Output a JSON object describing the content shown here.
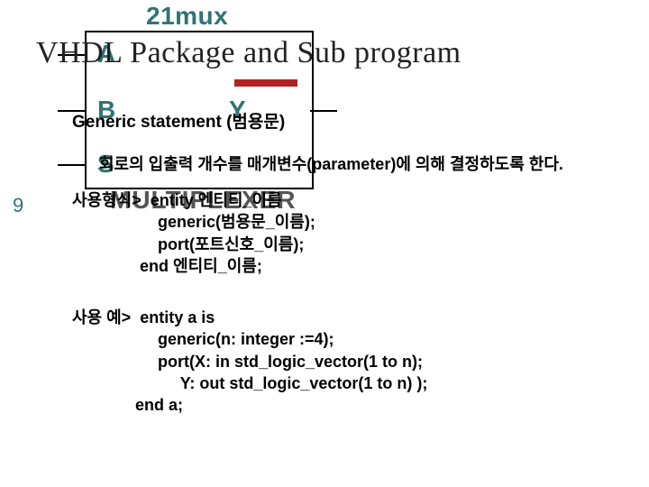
{
  "schematic": {
    "title": "21mux",
    "port_a": "A",
    "port_b": "B",
    "port_s": "S",
    "port_y": "Y",
    "chip_label": "MULTIPLEXER",
    "side_number": "9"
  },
  "slide": {
    "headline": "VHDL Package and Sub program",
    "section_title": "Generic statement (범용문)",
    "description": "회로의 입출력 개수를 매개변수(parameter)에 의해 결정하도록 한다.",
    "usage": "사용형식>  entity 엔티티_이름\n                   generic(범용문_이름);\n                   port(포트신호_이름);\n               end 엔티티_이름;",
    "example": "사용 예>  entity a is\n                   generic(n: integer :=4);\n                   port(X: in std_logic_vector(1 to n);\n                        Y: out std_logic_vector(1 to n) );\n              end a;"
  }
}
